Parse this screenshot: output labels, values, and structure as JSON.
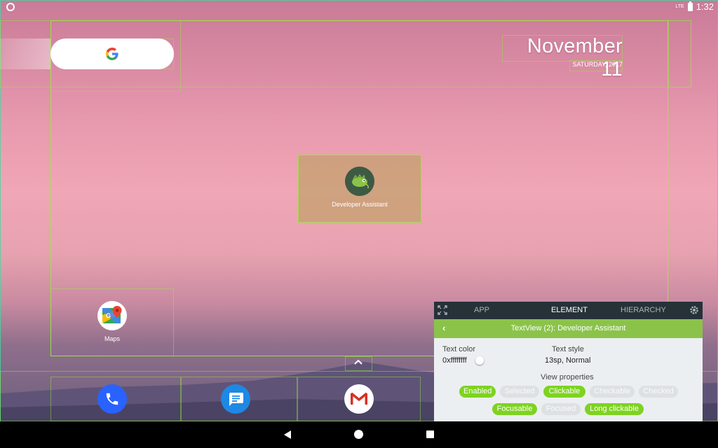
{
  "status_bar": {
    "network_label": "LTE",
    "time": "1:32"
  },
  "home": {
    "date": "November 11",
    "day": "SATURDAY, 2017",
    "apps": [
      {
        "label": "Developer Assistant",
        "icon": "chameleon-icon"
      },
      {
        "label": "Maps",
        "icon": "maps-pin-icon"
      }
    ],
    "dock": [
      {
        "icon": "phone-icon"
      },
      {
        "icon": "messages-icon"
      },
      {
        "icon": "gmail-icon"
      }
    ]
  },
  "inspector": {
    "tabs": [
      "APP",
      "ELEMENT",
      "HIERARCHY"
    ],
    "active_tab": "ELEMENT",
    "title": "TextView (2): Developer Assistant",
    "text_color_label": "Text color",
    "text_color_value": "0xffffffff",
    "text_style_label": "Text style",
    "text_style_value": "13sp, Normal",
    "view_properties_label": "View properties",
    "properties": [
      {
        "label": "Enabled",
        "on": true
      },
      {
        "label": "Selected",
        "on": false
      },
      {
        "label": "Clickable",
        "on": true
      },
      {
        "label": "Checkable",
        "on": false
      },
      {
        "label": "Checked",
        "on": false
      },
      {
        "label": "Focusable",
        "on": true
      },
      {
        "label": "Focused",
        "on": false
      },
      {
        "label": "Long clickable",
        "on": true
      }
    ]
  },
  "colors": {
    "accent": "#8bc34a",
    "panel_dark": "#263238",
    "chip_on": "#7ed321"
  }
}
